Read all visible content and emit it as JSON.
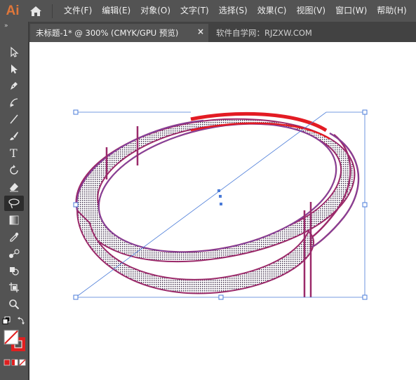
{
  "app": {
    "logo_text": "Ai",
    "brand_color": "#e0773a"
  },
  "menu": {
    "items": [
      {
        "label": "文件(F)"
      },
      {
        "label": "编辑(E)"
      },
      {
        "label": "对象(O)"
      },
      {
        "label": "文字(T)"
      },
      {
        "label": "选择(S)"
      },
      {
        "label": "效果(C)"
      },
      {
        "label": "视图(V)"
      },
      {
        "label": "窗口(W)"
      },
      {
        "label": "帮助(H)"
      }
    ]
  },
  "tabs": {
    "active": {
      "title": "未标题-1* @ 300% (CMYK/GPU 预览)",
      "close_glyph": "×"
    },
    "inactive": {
      "title": "软件自学网：RJZXW.COM"
    }
  },
  "toolbox": {
    "grip": "»",
    "tools": [
      {
        "icon": "selection-tool-icon"
      },
      {
        "icon": "direct-selection-tool-icon"
      },
      {
        "icon": "pen-tool-icon"
      },
      {
        "icon": "curvature-tool-icon"
      },
      {
        "icon": "line-segment-tool-icon"
      },
      {
        "icon": "paintbrush-tool-icon"
      },
      {
        "icon": "type-tool-icon",
        "glyph": "T"
      },
      {
        "icon": "rotate-tool-icon"
      },
      {
        "icon": "eraser-tool-icon"
      },
      {
        "icon": "lasso-tool-icon",
        "active": true
      },
      {
        "icon": "gradient-tool-icon"
      },
      {
        "icon": "eyedropper-tool-icon"
      },
      {
        "icon": "blend-tool-icon"
      },
      {
        "icon": "shape-builder-tool-icon"
      },
      {
        "icon": "artboard-tool-icon"
      },
      {
        "icon": "zoom-tool-icon"
      }
    ],
    "fill_stroke": {
      "fill": "none",
      "stroke": "#e02020"
    }
  },
  "colors": {
    "ring_outline": "#9b2a6a",
    "ring_highlight": "#6a55c8",
    "red_stroke": "#e31b23",
    "bbox": "#4a7bd8"
  }
}
